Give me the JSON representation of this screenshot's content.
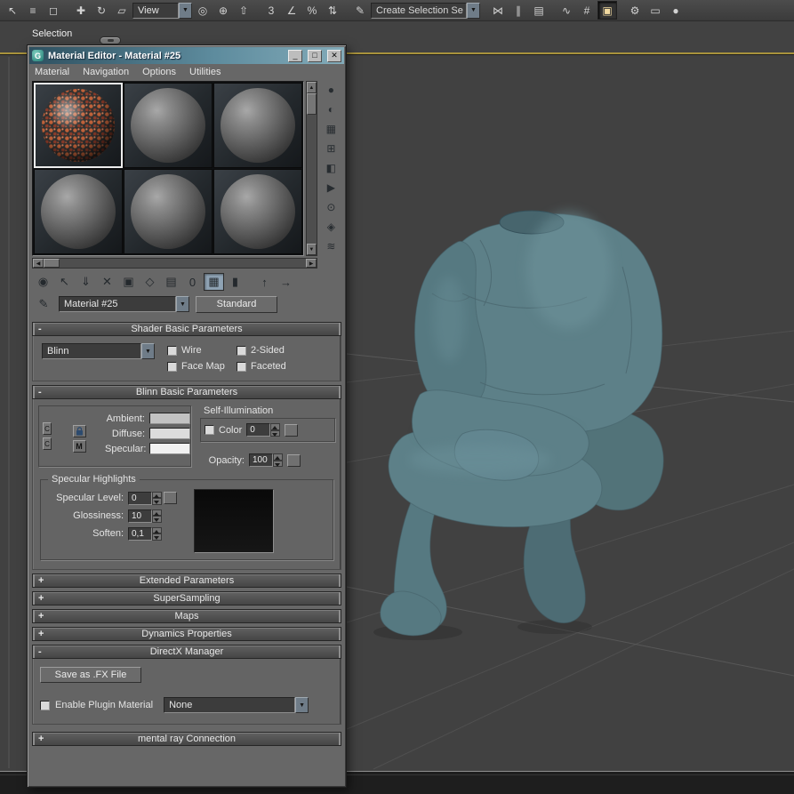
{
  "ui": {
    "arrow_down": "▼",
    "arrow_up": "▲",
    "arrow_left": "◀",
    "arrow_right": "▶",
    "bracket_lock": "C"
  },
  "colors": {
    "viewport_bg": "#414141",
    "active_viewport_border": "#a8923c",
    "model_base": "#5d8088",
    "titlebar_start": "#2e5060",
    "titlebar_end": "#83abb9",
    "selected_slot_border": "#ececec",
    "speckle_orange": "#c06038"
  },
  "top_toolbar": {
    "buttons": [
      {
        "name": "select-object",
        "glyph": "↖"
      },
      {
        "name": "select-by-name",
        "glyph": "≡"
      },
      {
        "name": "rectangular-selection-region",
        "glyph": "◻"
      },
      {
        "name": "select-and-move",
        "glyph": "✚"
      },
      {
        "name": "select-and-rotate",
        "glyph": "↻"
      },
      {
        "name": "select-and-scale",
        "glyph": "▱"
      },
      {
        "name": "use-pivot-center",
        "glyph": "◎"
      },
      {
        "name": "select-and-manipulate",
        "glyph": "⊕"
      },
      {
        "name": "keyboard-override",
        "glyph": "⇧"
      },
      {
        "name": "snap-toggle-3d",
        "glyph": "3"
      },
      {
        "name": "angle-snap",
        "glyph": "∠"
      },
      {
        "name": "percent-snap",
        "glyph": "%"
      },
      {
        "name": "spinner-snap",
        "glyph": "⇅"
      },
      {
        "name": "edit-named-selection-sets",
        "glyph": "✎"
      },
      {
        "name": "mirror",
        "glyph": "⋈"
      },
      {
        "name": "align",
        "glyph": "∥"
      },
      {
        "name": "layer-manager",
        "glyph": "▤"
      },
      {
        "name": "curve-editor",
        "glyph": "∿"
      },
      {
        "name": "schematic-view",
        "glyph": "#"
      },
      {
        "name": "material-editor",
        "glyph": "▣"
      },
      {
        "name": "render-setup",
        "glyph": "⚙"
      },
      {
        "name": "rendered-frame-window",
        "glyph": "▭"
      },
      {
        "name": "render-production",
        "glyph": "●"
      }
    ],
    "view_combo": {
      "value": "View"
    },
    "selection_set_combo": {
      "value": "Create Selection Se"
    }
  },
  "selection_bar": {
    "label": "Selection"
  },
  "material_editor": {
    "title": "Material Editor - Material #25",
    "window_icon_glyph": "G",
    "window_buttons": {
      "minimize": "_",
      "maximize": "□",
      "close": "✕"
    },
    "menu": {
      "items": [
        "Material",
        "Navigation",
        "Options",
        "Utilities"
      ]
    },
    "sample_slots": {
      "rows": 2,
      "cols": 3,
      "selected_index": 0
    },
    "side_toolbar": [
      {
        "name": "sample-type",
        "glyph": "●"
      },
      {
        "name": "backlight",
        "glyph": "◐"
      },
      {
        "name": "background",
        "glyph": "▦"
      },
      {
        "name": "sample-uv-tiling",
        "glyph": "⊞"
      },
      {
        "name": "video-color-check",
        "glyph": "◧"
      },
      {
        "name": "make-preview",
        "glyph": "▶"
      },
      {
        "name": "options",
        "glyph": "⊙"
      },
      {
        "name": "select-by-material",
        "glyph": "◈"
      },
      {
        "name": "material-map-navigator",
        "glyph": "≋"
      }
    ],
    "toolbar": [
      {
        "name": "get-material",
        "glyph": "◉"
      },
      {
        "name": "put-material-to-scene",
        "glyph": "↖"
      },
      {
        "name": "assign-material-to-selection",
        "glyph": "⇓"
      },
      {
        "name": "reset-map",
        "glyph": "✕"
      },
      {
        "name": "make-material-copy",
        "glyph": "▣"
      },
      {
        "name": "make-unique",
        "glyph": "◇"
      },
      {
        "name": "put-to-library",
        "glyph": "▤"
      },
      {
        "name": "material-effects-channel",
        "glyph": "0"
      },
      {
        "name": "show-map-in-viewport",
        "glyph": "▦"
      },
      {
        "name": "show-end-result",
        "glyph": "▮"
      },
      {
        "name": "go-to-parent",
        "glyph": "↑"
      },
      {
        "name": "go-forward-to-sibling",
        "glyph": "→"
      }
    ],
    "name_row": {
      "eyedropper_glyph": "✎",
      "material_name": "Material #25",
      "type_button": "Standard"
    },
    "swatches": {
      "ambient": "#c2c2c2",
      "diffuse": "#dcdcdc",
      "specular": "#f0f0f0"
    },
    "rollouts": {
      "shader": {
        "state": "-",
        "title": "Shader Basic Parameters",
        "shader_value": "Blinn",
        "checkboxes": [
          {
            "label": "Wire",
            "checked": false
          },
          {
            "label": "2-Sided",
            "checked": false
          },
          {
            "label": "Face Map",
            "checked": false
          },
          {
            "label": "Faceted",
            "checked": false
          }
        ]
      },
      "blinn": {
        "state": "-",
        "title": "Blinn Basic Parameters",
        "ambient_label": "Ambient:",
        "diffuse_label": "Diffuse:",
        "specular_label": "Specular:",
        "map_button": "M",
        "self_illumination": {
          "title": "Self-Illumination",
          "color_label": "Color",
          "value": "0",
          "checked": false
        },
        "opacity": {
          "label": "Opacity:",
          "value": "100"
        },
        "specular_highlights": {
          "title": "Specular Highlights",
          "rows": [
            {
              "label": "Specular Level:",
              "value": "0"
            },
            {
              "label": "Glossiness:",
              "value": "10"
            },
            {
              "label": "Soften:",
              "value": "0,1"
            }
          ]
        }
      },
      "collapsed": [
        {
          "state": "+",
          "title": "Extended Parameters"
        },
        {
          "state": "+",
          "title": "SuperSampling"
        },
        {
          "state": "+",
          "title": "Maps"
        },
        {
          "state": "+",
          "title": "Dynamics Properties"
        }
      ],
      "directx": {
        "state": "-",
        "title": "DirectX Manager",
        "save_button": "Save as .FX File",
        "enable_label": "Enable Plugin Material",
        "enable_checked": false,
        "plugin_value": "None"
      },
      "mental_ray": {
        "state": "+",
        "title": "mental ray Connection"
      }
    }
  }
}
